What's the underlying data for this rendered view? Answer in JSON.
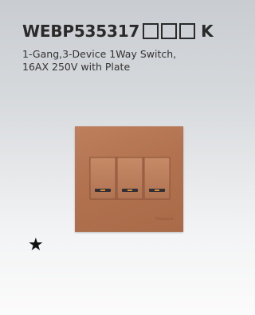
{
  "product": {
    "model": "WEBP535317",
    "suffix": "K",
    "description_line1": "1-Gang,3-Device 1Way Switch,",
    "description_line2": "16AX 250V with Plate"
  },
  "image": {
    "plate_color": "#b27250",
    "rocker_count": 3,
    "indicator_color": "#d98a3a",
    "brand_mark": "Panasonic"
  },
  "marker": {
    "symbol": "★"
  }
}
